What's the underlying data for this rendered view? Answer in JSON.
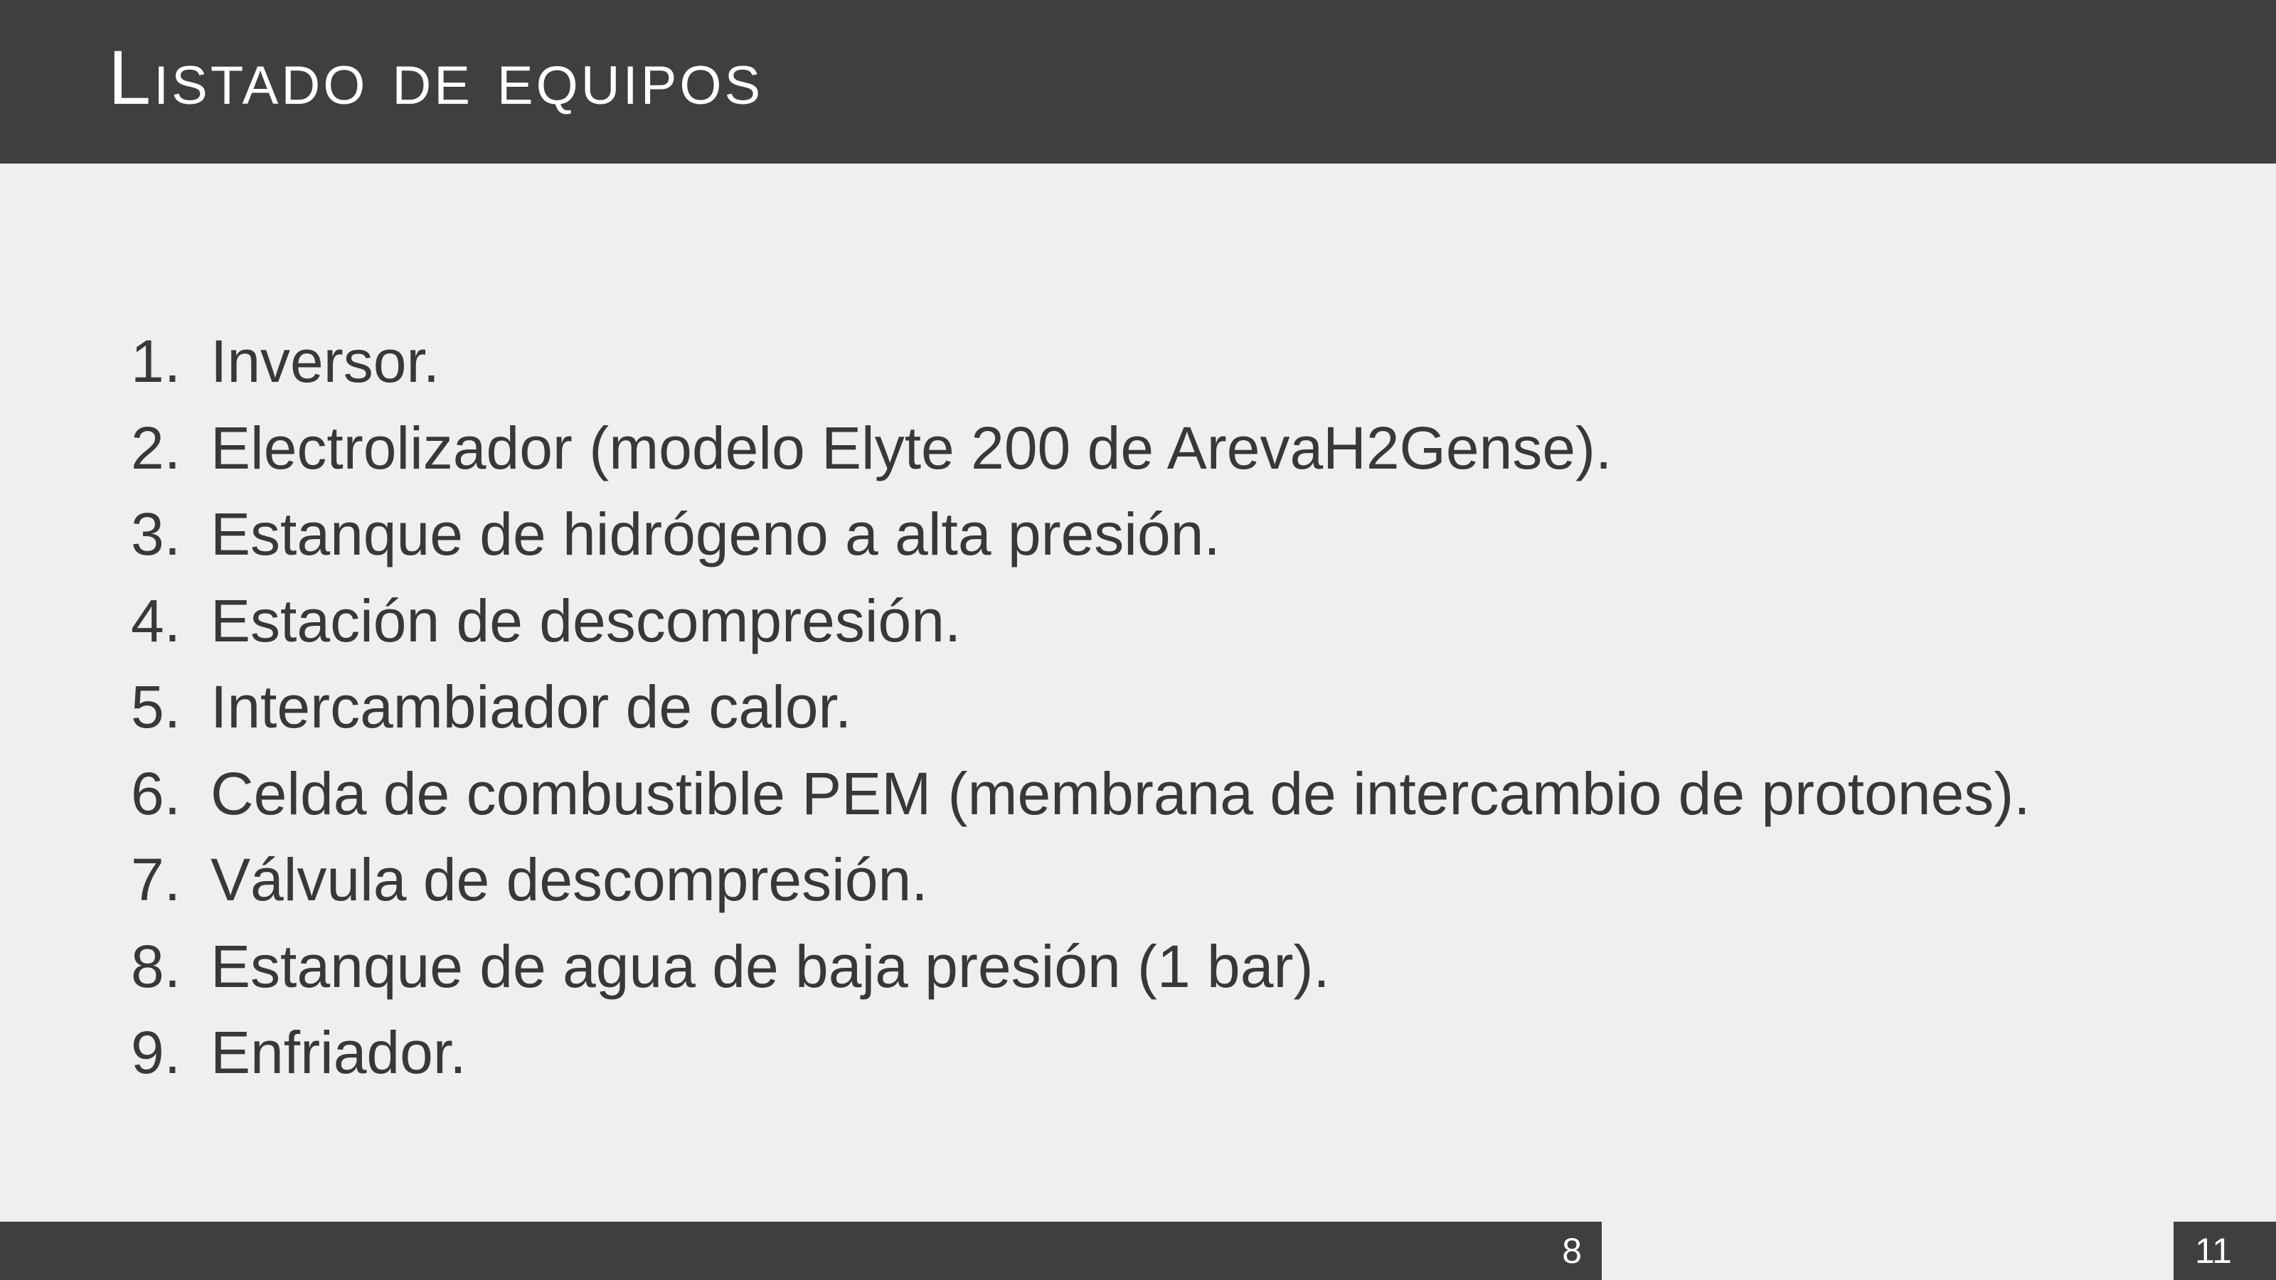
{
  "slide": {
    "title": "Listado de equipos"
  },
  "items": [
    {
      "num": "1.",
      "text": "Inversor."
    },
    {
      "num": "2.",
      "text": "Electrolizador (modelo Elyte 200 de ArevaH2Gense)."
    },
    {
      "num": "3.",
      "text": "Estanque de hidrógeno a alta presión."
    },
    {
      "num": "4.",
      "text": "Estación de descompresión."
    },
    {
      "num": "5.",
      "text": "Intercambiador de calor."
    },
    {
      "num": "6.",
      "text": "Celda de combustible PEM (membrana de intercambio de protones)."
    },
    {
      "num": "7.",
      "text": "Válvula de descompresión."
    },
    {
      "num": "8.",
      "text": "Estanque de agua de baja presión (1 bar)."
    },
    {
      "num": "9.",
      "text": "Enfriador."
    }
  ],
  "footer": {
    "current_page": "8",
    "total_pages": "11"
  }
}
